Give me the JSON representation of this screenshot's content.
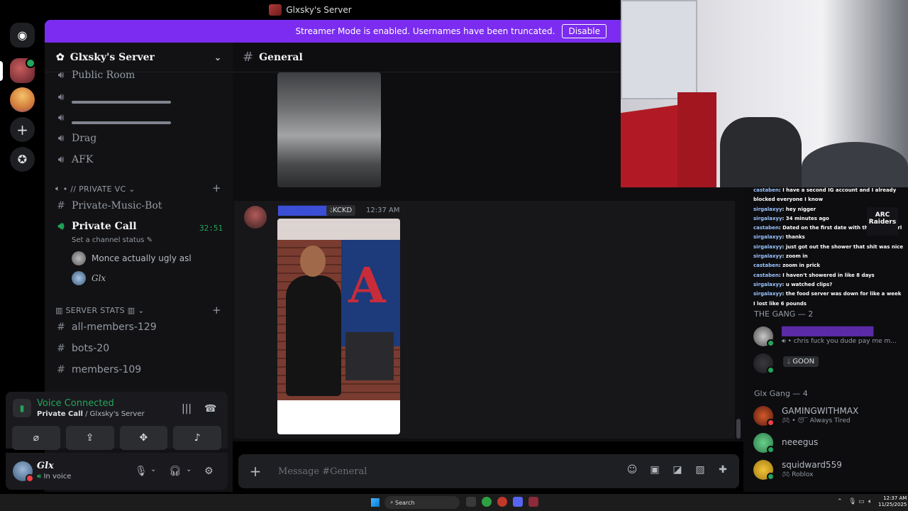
{
  "window": {
    "title": "Glxsky's Server"
  },
  "banner": {
    "text": "Streamer Mode is enabled. Usernames have been truncated.",
    "button": "Disable"
  },
  "server": {
    "name": "Glxsky's Server"
  },
  "channels": {
    "public_room": "Public Room",
    "drag": "Drag",
    "afk": "AFK",
    "private_vc_category": "• // PRIVATE VC",
    "music_bot": "Private-Music-Bot",
    "private_call": "Private Call",
    "private_call_timer": "32:51",
    "set_status": "Set a channel status",
    "members": [
      {
        "name": "Monce actually ugly asl"
      },
      {
        "name": "Glx"
      }
    ],
    "stats_category": "SERVER STATS",
    "all_members": "all-members-129",
    "bots": "bots-20",
    "members_count": "members-109"
  },
  "voice": {
    "status": "Voice Connected",
    "channel": "Private Call",
    "server_suffix": " / Glxsky's Server"
  },
  "user": {
    "name": "Glx",
    "status": "In voice"
  },
  "chat": {
    "channel": "General",
    "message": {
      "tag": "KCKD",
      "time": "12:37 AM"
    },
    "placeholder": "Message #General"
  },
  "overlay_chat": [
    {
      "user": "castaben",
      "text": "I have a second IG account and I already blocked everyone I know"
    },
    {
      "user": "sirgalaxyy",
      "text": "hey nigger"
    },
    {
      "user": "sirgalaxyy",
      "text": "34 minutes ago"
    },
    {
      "user": "castaben",
      "text": "Dated on the first date with the target girl"
    },
    {
      "user": "sirgalaxyy",
      "text": "thanks"
    },
    {
      "user": "sirgalaxyy",
      "text": "just got out the shower that shit was nice"
    },
    {
      "user": "sirgalaxyy",
      "text": "zoom in"
    },
    {
      "user": "castaben",
      "text": "zoom in prick"
    },
    {
      "user": "castaben",
      "text": "I haven't showered in like 8 days"
    },
    {
      "user": "sirgalaxyy",
      "text": "u watched clips?"
    },
    {
      "user": "sirgalaxyy",
      "text": "the food server was down for like a week I lost like 6 pounds"
    }
  ],
  "overlay_badge": "ARC Raiders",
  "member_groups": {
    "gang": "THE GANG — 2",
    "glx_gang": "Glx Gang — 4"
  },
  "members_list": {
    "gang_1_status": "chris fuck you dude pay me m...",
    "gang_2_tag": "GOON",
    "glx_1_name": "GAMINGWITHMAX",
    "glx_1_status": "Always Tired",
    "glx_2_name": "neeegus",
    "glx_3_name": "squidward559",
    "glx_3_status": "Roblox"
  },
  "taskbar": {
    "search": "Search",
    "time": "12:37 AM",
    "date": "11/25/2025"
  },
  "colors": {
    "accent": "#7b2cf0",
    "online": "#23a55a",
    "dnd": "#f23f43"
  }
}
